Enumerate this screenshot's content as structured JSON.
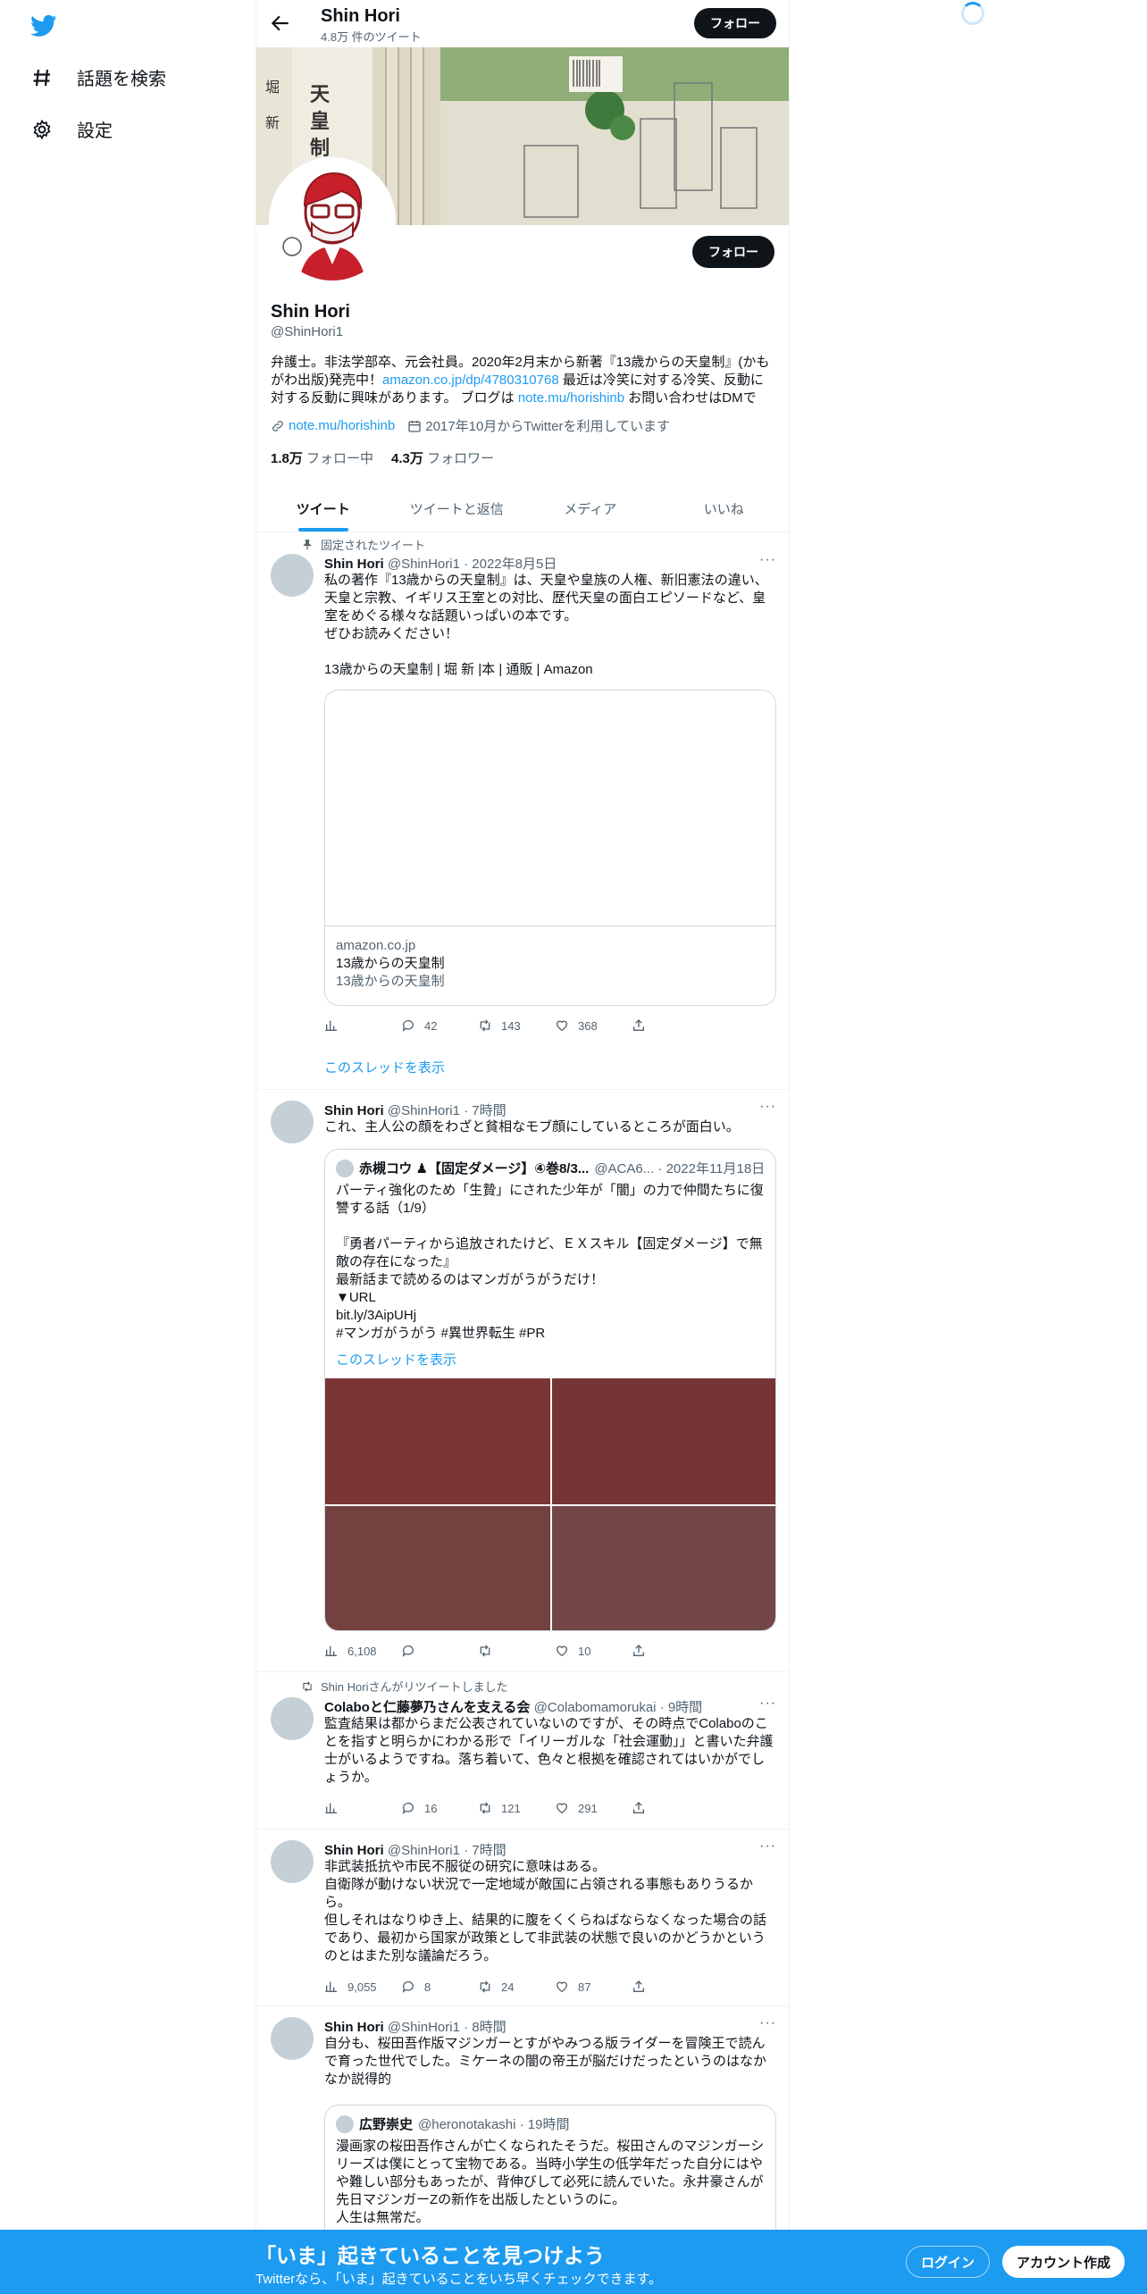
{
  "nav": {
    "explore": "話題を検索",
    "settings": "設定"
  },
  "header": {
    "name": "Shin Hori",
    "tweet_count": "4.8万 件のツイート",
    "follow": "フォロー"
  },
  "profile": {
    "follow": "フォロー",
    "name": "Shin Hori",
    "handle": "@ShinHori1",
    "bio_1": "弁護士。非法学部卒、元会社員。2020年2月末から新著『13歳からの天皇制』(かもがわ出版)発売中！",
    "bio_link_1": "amazon.co.jp/dp/4780310768",
    "bio_2": " 最近は冷笑に対する冷笑、反動に対する反動に興味があります。 ブログは ",
    "bio_link_2": "note.mu/horishinb",
    "bio_3": " お問い合わせはDMで",
    "website": "note.mu/horishinb",
    "joined": "2017年10月からTwitterを利用しています",
    "following_num": "1.8万",
    "following_label": "フォロー中",
    "followers_num": "4.3万",
    "followers_label": "フォロワー"
  },
  "tabs": [
    "ツイート",
    "ツイートと返信",
    "メディア",
    "いいね"
  ],
  "tweets": {
    "t1": {
      "context": "固定されたツイート",
      "name": "Shin Hori",
      "meta": "@ShinHori1 · 2022年8月5日",
      "more": "···",
      "body": "私の著作『13歳からの天皇制』は、天皇や皇族の人権、新旧憲法の違い、天皇と宗教、イギリス王室との対比、歴代天皇の面白エピソードなど、皇室をめぐる様々な話題いっぱいの本です。\nぜひお読みください！\n\n13歳からの天皇制 | 堀 新 |本 | 通販 | Amazon",
      "card_domain": "amazon.co.jp",
      "card_title": "13歳からの天皇制",
      "card_desc": "13歳からの天皇制",
      "views": "",
      "replies": "42",
      "retweets": "143",
      "likes": "368",
      "thread": "このスレッドを表示"
    },
    "t2": {
      "name": "Shin Hori",
      "meta": "@ShinHori1 · 7時間",
      "more": "···",
      "body": "これ、主人公の顔をわざと貧相なモブ顔にしているところが面白い。",
      "q_name": "赤槻コウ ♟【固定ダメージ】④巻8/3...",
      "q_meta": "@ACA6... · 2022年11月18日",
      "q_body": "パーティ強化のため「生贄」にされた少年が「闇」の力で仲間たちに復讐する話（1/9）\n\n『勇者パーティから追放されたけど、ＥＸスキル【固定ダメージ】で無敵の存在になった』\n最新話まで読めるのはマンガがうがうだけ！\n▼URL\nbit.ly/3AipUHj\n#マンガがうがう #異世界転生 #PR",
      "q_thread": "このスレッドを表示",
      "views": "6,108",
      "replies": "",
      "retweets": "",
      "likes": "10"
    },
    "t3": {
      "context": "Shin Horiさんがリツイートしました",
      "name": "Colaboと仁藤夢乃さんを支える会",
      "meta": "@Colabomamorukai · 9時間",
      "more": "···",
      "body": "監査結果は都からまだ公表されていないのですが、その時点でColaboのことを指すと明らかにわかる形で「イリーガルな「社会運動」」と書いた弁護士がいるようですね。落ち着いて、色々と根拠を確認されてはいかがでしょうか。",
      "views": "",
      "replies": "16",
      "retweets": "121",
      "likes": "291"
    },
    "t4": {
      "name": "Shin Hori",
      "meta": "@ShinHori1 · 7時間",
      "more": "···",
      "body": "非武装抵抗や市民不服従の研究に意味はある。\n自衛隊が動けない状況で一定地域が敵国に占領される事態もありうるから。\n但しそれはなりゆき上、結果的に腹をくくらねばならなくなった場合の話であり、最初から国家が政策として非武装の状態で良いのかどうかというのとはまた別な議論だろう。",
      "views": "9,055",
      "replies": "8",
      "retweets": "24",
      "likes": "87"
    },
    "t5": {
      "name": "Shin Hori",
      "meta": "@ShinHori1 · 8時間",
      "more": "···",
      "body": "自分も、桜田吾作版マジンガーとすがやみつる版ライダーを冒険王で読んで育った世代でした。ミケーネの闇の帝王が脳だけだったというのはなかなか説得的",
      "q_name": "広野崇史",
      "q_meta": "@heronotakashi · 19時間",
      "q_body": "漫画家の桜田吾作さんが亡くなられたそうだ。桜田さんのマジンガーシリーズは僕にとって宝物である。当時小学生の低学年だった自分にはやや難しい部分もあったが、背伸びして必死に読んでいた。永井豪さんが先日マジンガーZの新作を出版したというのに。\n人生は無常だ。"
    }
  },
  "bottom_bar": {
    "title": "「いま」起きていることを見つけよう",
    "subtitle": "Twitterなら、「いま」起きていることをいち早くチェックできます。",
    "login": "ログイン",
    "signup": "アカウント作成"
  },
  "colors": {
    "accent": "#1d9bf0",
    "text": "#0f1419",
    "secondary": "#536471",
    "media_red": "#7a3535"
  }
}
